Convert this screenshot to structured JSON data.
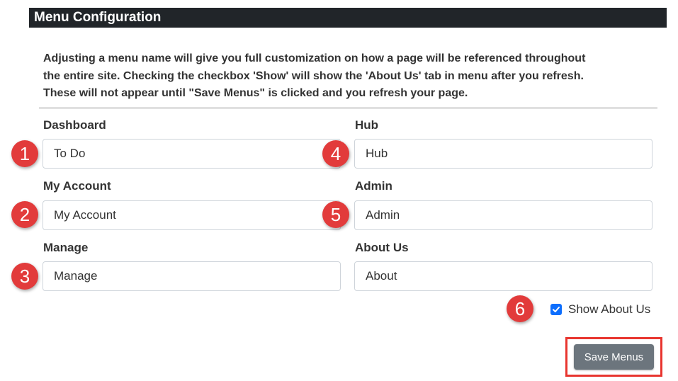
{
  "header": {
    "title": "Menu Configuration"
  },
  "description": {
    "line1": "Adjusting a menu name will give you full customization on how a page will be referenced throughout",
    "line2": "the entire site. Checking the checkbox 'Show' will show the 'About Us' tab in menu after you refresh.",
    "line3": "These will not appear until \"Save Menus\" is clicked and you refresh your page."
  },
  "fields": {
    "dashboard": {
      "label": "Dashboard",
      "value": "To Do"
    },
    "my_account": {
      "label": "My Account",
      "value": "My Account"
    },
    "manage": {
      "label": "Manage",
      "value": "Manage"
    },
    "hub": {
      "label": "Hub",
      "value": "Hub"
    },
    "admin": {
      "label": "Admin",
      "value": "Admin"
    },
    "about_us": {
      "label": "About Us",
      "value": "About"
    }
  },
  "badges": {
    "b1": "1",
    "b2": "2",
    "b3": "3",
    "b4": "4",
    "b5": "5",
    "b6": "6"
  },
  "checkbox": {
    "label": "Show About Us",
    "checked": true
  },
  "actions": {
    "save_label": "Save Menus"
  },
  "colors": {
    "header_bg": "#212529",
    "badge": "#e23b3b",
    "checkbox": "#0d6efd",
    "save_button": "#6c757d",
    "highlight": "#e8352f"
  }
}
